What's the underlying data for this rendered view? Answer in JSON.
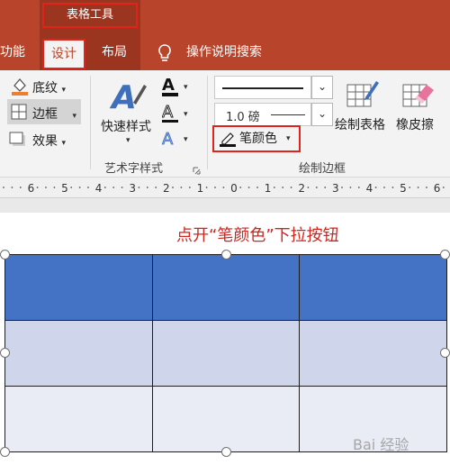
{
  "context_tab": "表格工具",
  "tabs": [
    {
      "label": "功能"
    },
    {
      "label": "设计"
    },
    {
      "label": "布局"
    },
    {
      "label": "操作说明搜索"
    }
  ],
  "ribbon": {
    "shading_label": "底纹",
    "border_label": "边框",
    "effects_label": "效果",
    "quick_styles_label": "快速样式",
    "wordart_group_label": "艺术字样式",
    "pen_weight_value": "1.0 磅",
    "pen_color_label": "笔颜色",
    "draw_table_label": "绘制表格",
    "eraser_label": "橡皮擦",
    "draw_borders_group_label": "绘制边框"
  },
  "ruler_ticks": [
    "6",
    "5",
    "4",
    "3",
    "2",
    "1",
    "0",
    "1",
    "2",
    "3",
    "4",
    "5",
    "6"
  ],
  "caption": "点开“笔颜色”下拉按钮",
  "watermark": "Bai 经验",
  "colors": {
    "ribbon_red": "#b8452b",
    "highlight_red": "#e0241c",
    "table_header": "#4472c4",
    "table_band": "#cfd5ea",
    "table_band_light": "#e9ebf5"
  }
}
